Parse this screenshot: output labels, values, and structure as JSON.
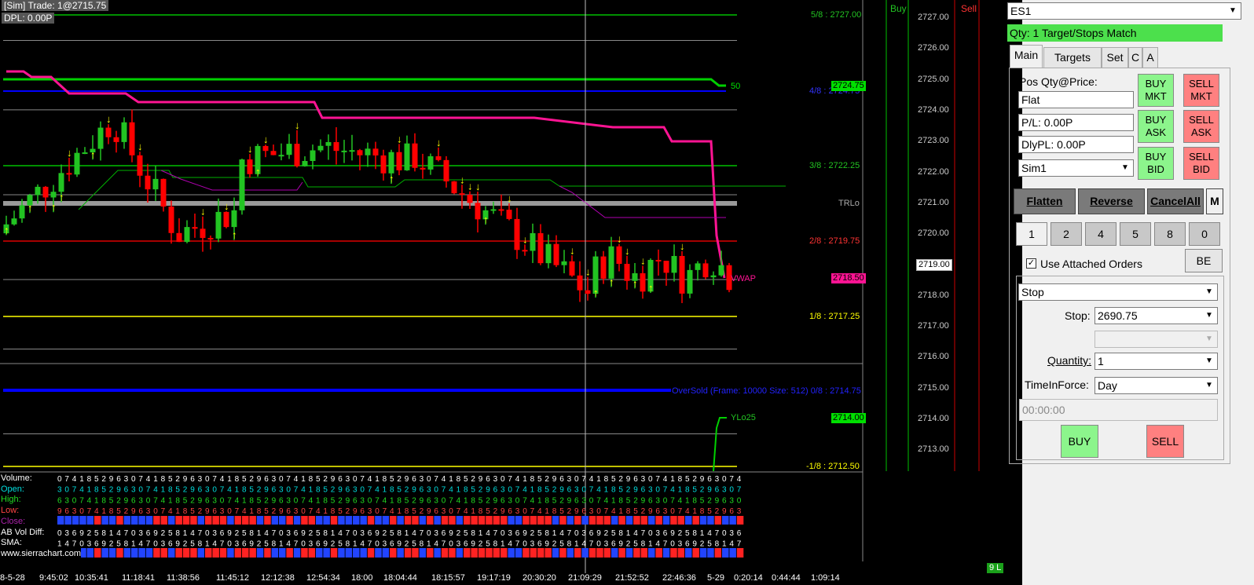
{
  "chart": {
    "trade_info": "[Sim]  Trade: 1@2715.75",
    "dpl": "DPL: 0.00P",
    "buy_label": "Buy",
    "sell_label": "Sell",
    "current_price": "2719.00",
    "watermark": "www.sierrachart.com",
    "status_badge": "9 L",
    "price_axis": [
      "2727.00",
      "2726.00",
      "2725.00",
      "2724.00",
      "2723.00",
      "2722.00",
      "2721.00",
      "2720.00",
      "2719.00",
      "2718.00",
      "2717.00",
      "2716.00",
      "2715.00",
      "2714.00",
      "2713.00"
    ],
    "levels": {
      "l58": "5/8 : 2727.00",
      "l48": "4/8 : 2724.75",
      "l48_tag": "2724.75",
      "l48_tail": "50",
      "l38": "3/8 : 2722.25",
      "trlo": "TRLo",
      "l28": "2/8 : 2719.75",
      "vwap": "VWAP",
      "vwap_tag": "2718.50",
      "l18": "1/8 : 2717.25",
      "oversold": "OverSold (Frame: 10000 Size: 512)  0/8 : 2714.75",
      "ylo": "YLo25",
      "ylo_tag": "2714.00",
      "lm18": "-1/8 : 2712.50"
    },
    "subgraph_labels": [
      "Volume:",
      "Open:",
      "High:",
      "Low:",
      "Close:",
      "AB Vol Diff:",
      "SMA:"
    ],
    "time_labels": [
      "8-5-28",
      "9:45:02",
      "10:35:41",
      "11:18:41",
      "11:38:56",
      "11:45:12",
      "12:12:38",
      "12:54:34",
      "18:00",
      "18:04:44",
      "18:15:57",
      "19:17:19",
      "20:30:20",
      "21:09:29",
      "21:52:52",
      "22:46:36",
      "5-29",
      "0:20:14",
      "0:44:44",
      "1:09:14"
    ],
    "colors": {
      "up": "#22c322",
      "down": "#ff0000",
      "pink": "#ff1493",
      "blue": "#0000ff",
      "green_line": "#00c000",
      "yellow": "#ffff00"
    }
  },
  "panel": {
    "symbol": "ES1",
    "status": "Qty: 1 Target/Stops Match",
    "tabs": [
      "Main",
      "Targets",
      "Set",
      "C",
      "A"
    ],
    "pos_label": "Pos Qty@Price:",
    "pos_value": "Flat",
    "pl_value": "P/L: 0.00P",
    "dlypl_value": "DlyPL: 0.00P",
    "account": "Sim1",
    "buy_mkt": "BUY\nMKT",
    "sell_mkt": "SELL\nMKT",
    "buy_ask": "BUY\nASK",
    "sell_ask": "SELL\nASK",
    "buy_bid": "BUY\nBID",
    "sell_bid": "SELL\nBID",
    "flatten": "Flatten",
    "reverse": "Reverse",
    "cancel_all": "CancelAll",
    "m_btn": "M",
    "qty_buttons": [
      "1",
      "2",
      "4",
      "5",
      "8",
      "0"
    ],
    "use_attached": "Use Attached Orders",
    "be_btn": "BE",
    "order_type": "Stop",
    "stop_label": "Stop:",
    "stop_value": "2690.75",
    "quantity_label": "Quantity:",
    "quantity_value": "1",
    "tif_label": "TimeInForce:",
    "tif_value": "Day",
    "time_value": "00:00:00",
    "buy_btn": "BUY",
    "sell_btn": "SELL"
  }
}
